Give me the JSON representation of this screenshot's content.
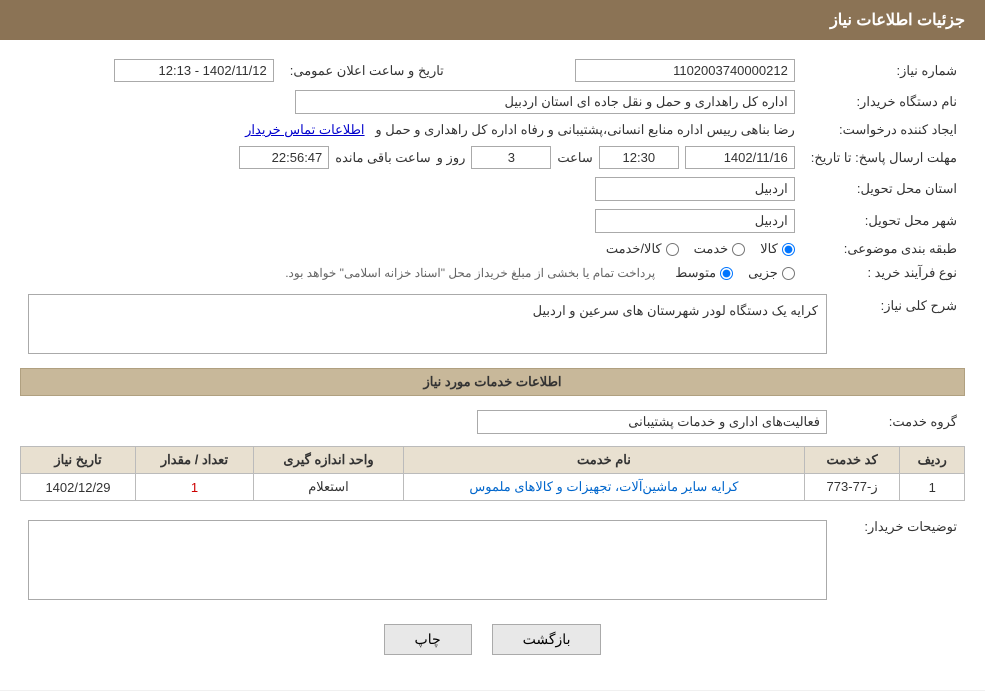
{
  "header": {
    "title": "جزئیات اطلاعات نیاز"
  },
  "info": {
    "need_number_label": "شماره نیاز:",
    "need_number_value": "1102003740000212",
    "buyer_org_label": "نام دستگاه خریدار:",
    "buyer_org_value": "اداره کل راهداری و حمل و نقل جاده ای استان اردبیل",
    "announce_datetime_label": "تاریخ و ساعت اعلان عمومی:",
    "announce_datetime_value": "1402/11/12 - 12:13",
    "creator_label": "ایجاد کننده درخواست:",
    "creator_value": "رضا بناهی رییس اداره منابع انسانی،پشتیبانی و رفاه اداره کل راهداری و حمل و",
    "creator_link": "اطلاعات تماس خریدار",
    "deadline_label": "مهلت ارسال پاسخ: تا تاریخ:",
    "deadline_date": "1402/11/16",
    "deadline_time": "12:30",
    "deadline_days": "3",
    "deadline_remaining": "22:56:47",
    "deadline_remaining_label": "ساعت باقی مانده",
    "province_label": "استان محل تحویل:",
    "province_value": "اردبیل",
    "city_label": "شهر محل تحویل:",
    "city_value": "اردبیل",
    "category_label": "طبقه بندی موضوعی:",
    "category_options": [
      "کالا",
      "خدمت",
      "کالا/خدمت"
    ],
    "category_selected": "کالا",
    "purchase_type_label": "نوع فرآیند خرید :",
    "purchase_options": [
      "جزیی",
      "متوسط"
    ],
    "purchase_note": "پرداخت تمام یا بخشی از مبلغ خریداز محل \"اسناد خزانه اسلامی\" خواهد بود.",
    "description_label": "شرح کلی نیاز:",
    "description_value": "کرایه یک دستگاه لودر  شهرستان های سرعین و اردبیل"
  },
  "services_section": {
    "title": "اطلاعات خدمات مورد نیاز",
    "service_group_label": "گروه خدمت:",
    "service_group_value": "فعالیت‌های اداری و خدمات پشتیبانی",
    "table": {
      "columns": [
        "ردیف",
        "کد خدمت",
        "نام خدمت",
        "واحد اندازه گیری",
        "تعداد / مقدار",
        "تاریخ نیاز"
      ],
      "rows": [
        {
          "row": "1",
          "code": "ز-77-773",
          "name": "کرایه سایر ماشین‌آلات، تجهیزات و کالاهای ملموس",
          "unit": "استعلام",
          "quantity": "1",
          "date": "1402/12/29"
        }
      ]
    }
  },
  "buyer_notes": {
    "label": "توضیحات خریدار:",
    "value": ""
  },
  "buttons": {
    "print_label": "چاپ",
    "back_label": "بازگشت"
  }
}
